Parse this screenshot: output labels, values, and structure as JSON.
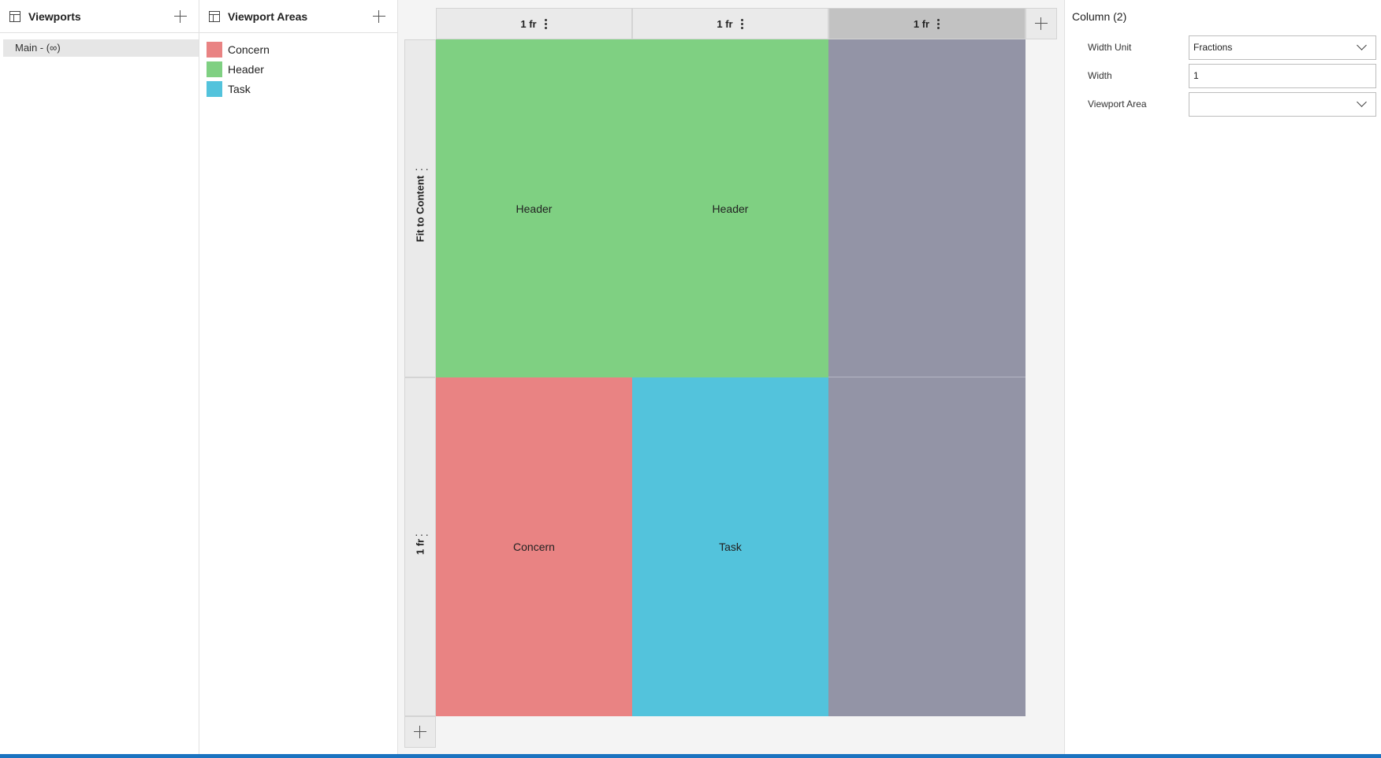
{
  "viewports": {
    "title": "Viewports",
    "items": [
      {
        "label": "Main - (∞)"
      }
    ]
  },
  "areas": {
    "title": "Viewport Areas",
    "items": [
      {
        "label": "Concern",
        "color": "#e98383"
      },
      {
        "label": "Header",
        "color": "#7fd082"
      },
      {
        "label": "Task",
        "color": "#53c3dc"
      }
    ]
  },
  "grid": {
    "columns": [
      {
        "label": "1 fr"
      },
      {
        "label": "1 fr"
      },
      {
        "label": "1 fr",
        "selected": true
      }
    ],
    "rows": [
      {
        "label": "Fit to Content"
      },
      {
        "label": "1 fr"
      }
    ],
    "cells": [
      {
        "label": "Header",
        "color": "#7fd082"
      },
      {
        "label": "Header",
        "color": "#7fd082"
      },
      {
        "label": "",
        "color": "#9394a6"
      },
      {
        "label": "Concern",
        "color": "#e98383"
      },
      {
        "label": "Task",
        "color": "#53c3dc"
      },
      {
        "label": "",
        "color": "#9394a6"
      }
    ]
  },
  "props": {
    "title": "Column (2)",
    "width_unit_label": "Width Unit",
    "width_unit_value": "Fractions",
    "width_label": "Width",
    "width_value": "1",
    "viewport_area_label": "Viewport Area",
    "viewport_area_value": ""
  },
  "colors": {
    "statusbar": "#1b73c0",
    "empty_cell": "#9394a6"
  }
}
